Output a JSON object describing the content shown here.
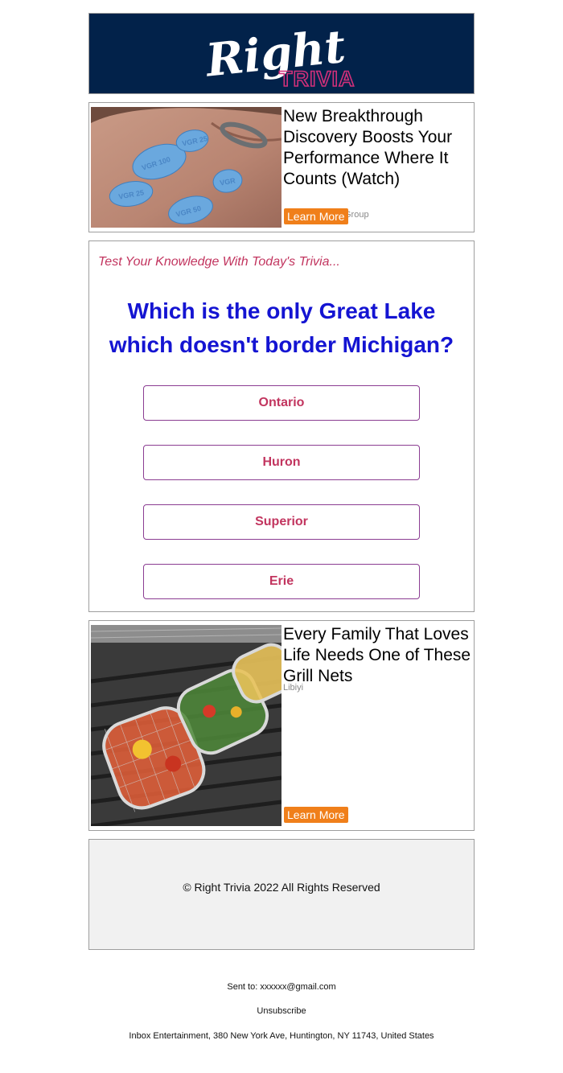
{
  "header": {
    "logo_script": "Right",
    "logo_sub": "TRIVIA",
    "bg_color": "#02224a",
    "sub_color": "#d2307a"
  },
  "ad_top": {
    "title": "New Breakthrough Discovery Boosts Your Performance Where It Counts (Watch)",
    "source": "Group",
    "cta": "Learn More",
    "pill_labels": [
      "VGR 100",
      "VGR 25",
      "VGR 25",
      "VGR 50",
      "VGR"
    ],
    "cta_color": "#f07f1a"
  },
  "quiz": {
    "intro": "Test Your Knowledge With Today's Trivia...",
    "question": "Which is the only Great Lake which doesn't border Michigan?",
    "answers": [
      "Ontario",
      "Huron",
      "Superior",
      "Erie"
    ],
    "question_color": "#1414d2",
    "answer_color": "#c2355f"
  },
  "ad_bottom": {
    "title": "Every Family That Loves Life Needs One of These Grill Nets",
    "source": "Libiyi",
    "cta": "Learn More"
  },
  "footer": {
    "copyright": "© Right Trivia 2022 All Rights Reserved",
    "sent_to": "Sent to: xxxxxx@gmail.com",
    "unsubscribe": "Unsubscribe",
    "address": "Inbox Entertainment, 380 New York Ave, Huntington, NY 11743, United States"
  }
}
